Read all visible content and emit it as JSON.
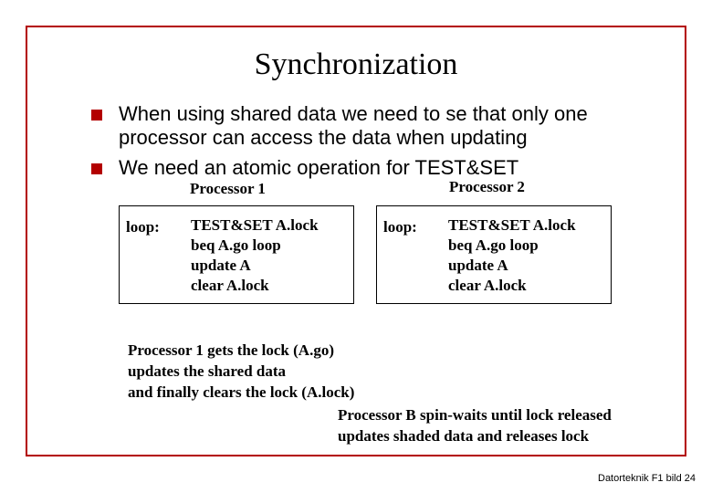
{
  "title": "Synchronization",
  "bullets": [
    "When using shared data we need to se that only one processor can access the data when updating",
    "We need an atomic operation for TEST&SET"
  ],
  "proc1": {
    "label": "Processor 1",
    "loop": "loop:",
    "code": "TEST&SET A.lock\nbeq A.go loop\nupdate A\nclear A.lock"
  },
  "proc2": {
    "label": "Processor 2",
    "loop": "loop:",
    "code": "TEST&SET A.lock\nbeq A.go loop\nupdate A\nclear A.lock"
  },
  "note1": "Processor 1 gets the lock (A.go)\nupdates the shared data\nand finally clears the lock (A.lock)",
  "note2": "Processor B spin-waits until lock released\nupdates shaded data and releases lock",
  "footer": "Datorteknik F1 bild 24"
}
